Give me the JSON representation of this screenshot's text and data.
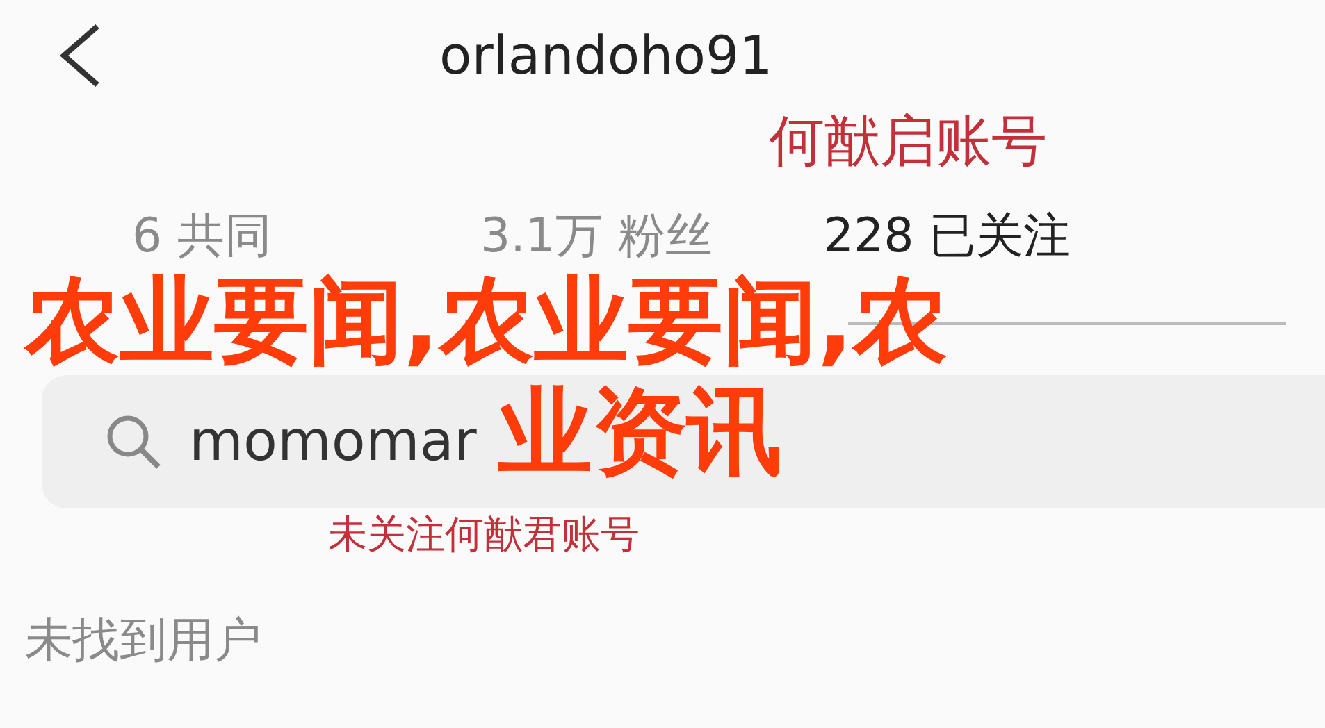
{
  "header": {
    "back_icon": true,
    "title": "orlandoho91"
  },
  "annotations": [
    {
      "text": "何猷启账号",
      "color": "#c4303a"
    },
    {
      "text": "未关注何猷君账号",
      "color": "#c4303a"
    }
  ],
  "stats": [
    {
      "number": "6",
      "label": "共同",
      "emphasis": false
    },
    {
      "number": "3.1万",
      "label": "粉丝",
      "emphasis": false
    },
    {
      "number": "228",
      "label": "已关注",
      "emphasis": true
    }
  ],
  "search": {
    "value": "momomar"
  },
  "message": "未找到用户",
  "headline": {
    "lines": [
      "农业要闻,农业要闻,农",
      "业资讯"
    ]
  }
}
